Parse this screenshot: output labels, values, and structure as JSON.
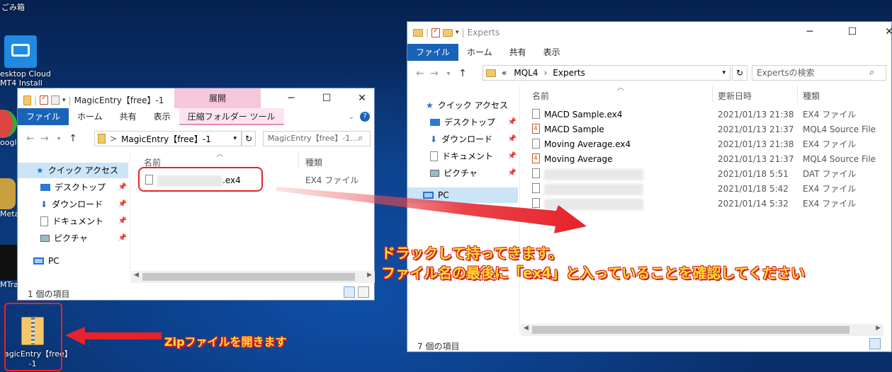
{
  "desktop": {
    "recycle_bin": "ごみ箱",
    "icon_cloud_line1": "esktop Cloud",
    "icon_cloud_line2": "MT4 Install",
    "icon_google": "oogle",
    "icon_meta": "Meta",
    "icon_mtrade": "MTrad",
    "zip_label_line1": "agicEntry【free】",
    "zip_label_line2": "-1"
  },
  "left_window": {
    "title": "MagicEntry【free】-1",
    "context_tab": "展開",
    "tabs": [
      "ファイル",
      "ホーム",
      "共有",
      "表示",
      "圧縮フォルダー ツール"
    ],
    "address_sep": ">",
    "address": "MagicEntry【free】-1",
    "search_placeholder": "MagicEntry【free】-1...",
    "nav_items": [
      {
        "label": "クイック アクセス",
        "pinned": false
      },
      {
        "label": "デスクトップ",
        "pinned": true
      },
      {
        "label": "ダウンロード",
        "pinned": true
      },
      {
        "label": "ドキュメント",
        "pinned": true
      },
      {
        "label": "ピクチャ",
        "pinned": true
      }
    ],
    "pc": "PC",
    "col_name": "名前",
    "col_type": "種類",
    "file": {
      "ext": ".ex4",
      "type": "EX4 ファイル"
    },
    "status": "1 個の項目"
  },
  "right_window": {
    "title": "Experts",
    "tabs": [
      "ファイル",
      "ホーム",
      "共有",
      "表示"
    ],
    "address_prefix": "«",
    "address_parts": [
      "MQL4",
      "Experts"
    ],
    "search_placeholder": "Expertsの検索",
    "nav_items": [
      {
        "label": "クイック アクセス",
        "pinned": false
      },
      {
        "label": "デスクトップ",
        "pinned": true
      },
      {
        "label": "ダウンロード",
        "pinned": true
      },
      {
        "label": "ドキュメント",
        "pinned": true
      },
      {
        "label": "ピクチャ",
        "pinned": true
      }
    ],
    "pc": "PC",
    "col_name": "名前",
    "col_date": "更新日時",
    "col_type": "種類",
    "files": [
      {
        "name": "MACD Sample.ex4",
        "date": "2021/01/13 21:38",
        "type": "EX4 ファイル",
        "icon": "file-icon"
      },
      {
        "name": "MACD Sample",
        "date": "2021/01/13 21:37",
        "type": "MQL4 Source File",
        "icon": "mql4-icon"
      },
      {
        "name": "Moving Average.ex4",
        "date": "2021/01/13 21:38",
        "type": "EX4 ファイル",
        "icon": "file-icon"
      },
      {
        "name": "Moving Average",
        "date": "2021/01/13 21:37",
        "type": "MQL4 Source File",
        "icon": "mql4-icon"
      },
      {
        "name": "",
        "date": "2021/01/18 5:51",
        "type": "DAT ファイル",
        "icon": "file-icon"
      },
      {
        "name": "",
        "date": "2021/01/18 5:42",
        "type": "EX4 ファイル",
        "icon": "file-icon"
      },
      {
        "name": "",
        "date": "2021/01/14 5:32",
        "type": "EX4 ファイル",
        "icon": "file-icon"
      }
    ],
    "status": "7 個の項目"
  },
  "annotations": {
    "drag_line1": "ドラックして持ってきます。",
    "drag_line2": "ファイル名の最後に「ex4」と入っていることを確認してください",
    "zip_note": "Zipファイルを開きます"
  },
  "colors": {
    "annotation_red": "#e6222a",
    "annotation_yellow": "#ffdd33",
    "ribbon_blue": "#1a64b8"
  }
}
